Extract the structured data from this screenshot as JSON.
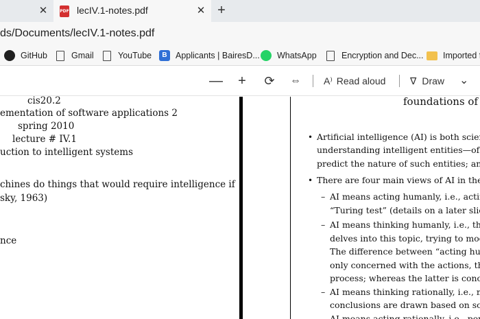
{
  "tabs": {
    "active_title": "lecIV.1-notes.pdf",
    "pdf_badge": "PDF",
    "close_glyph": "✕",
    "new_tab_glyph": "+"
  },
  "address": {
    "url": "ds/Documents/lecIV.1-notes.pdf"
  },
  "bookmarks": [
    {
      "label": "GitHub",
      "icon": "github-icon"
    },
    {
      "label": "Gmail",
      "icon": "page-icon"
    },
    {
      "label": "YouTube",
      "icon": "page-icon"
    },
    {
      "label": "Applicants | BairesD...",
      "icon": "bairesdev-icon"
    },
    {
      "label": "WhatsApp",
      "icon": "whatsapp-icon"
    },
    {
      "label": "Encryption and Dec...",
      "icon": "page-icon"
    },
    {
      "label": "Imported f",
      "icon": "folder-icon"
    }
  ],
  "pdf_toolbar": {
    "zoom_out": "—",
    "zoom_in": "+",
    "rotate": "⟳",
    "fit": "⇔",
    "read_aloud": "Read aloud",
    "read_aloud_icon": "A⁾",
    "draw": "Draw",
    "draw_icon": "∇",
    "more": "⌄"
  },
  "left_page": {
    "lines": [
      "cis20.2",
      "ementation of software applications 2",
      "spring 2010",
      "lecture # IV.1",
      "uction to intelligent systems",
      "chines do things that would require intelligence if",
      "sky, 1963)",
      "nce"
    ]
  },
  "right_page": {
    "title": "foundations of a",
    "bullet1": [
      "Artificial intelligence (AI) is both science",
      "understanding intelligent entities—of dev",
      "predict the nature of such entities; and it"
    ],
    "bullet2": "There are four main views of AI in the li",
    "sub": [
      {
        "dash": "–",
        "lines": [
          "AI means acting humanly, i.e., acting",
          "“Turing test” (details on a later slide"
        ]
      },
      {
        "dash": "–",
        "lines": [
          "AI means thinking humanly, i.e., thin",
          "delves into this topic, trying to mode",
          "The difference between “acting huma",
          "only concerned with the actions, the",
          "process; whereas the latter is concern"
        ]
      },
      {
        "dash": "–",
        "lines": [
          "AI means thinking rationally, i.e., mo",
          "conclusions are drawn based on some"
        ]
      },
      {
        "dash": "–",
        "lines": [
          "AI means acting rationally, i.e., perfo"
        ]
      }
    ],
    "bullet_glyph": "•"
  }
}
